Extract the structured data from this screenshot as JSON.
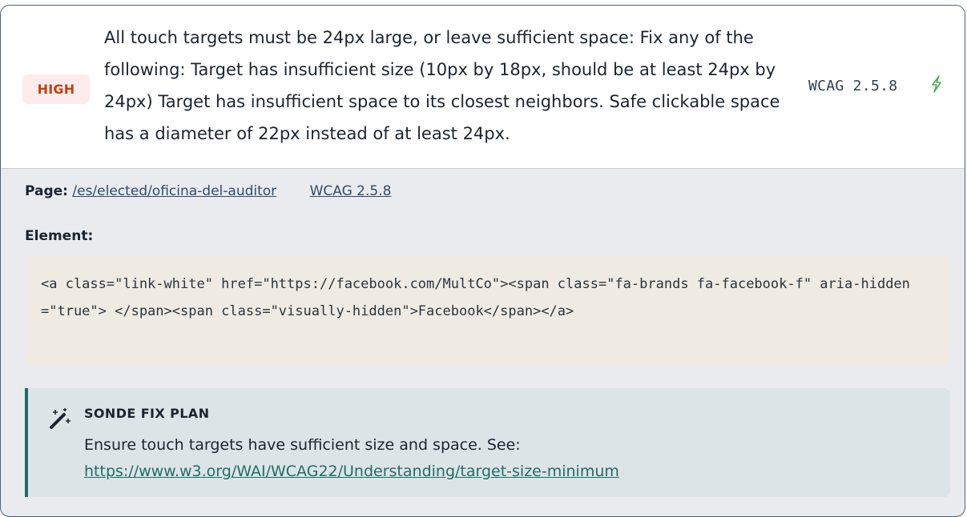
{
  "issue": {
    "severity": "HIGH",
    "description": "All touch targets must be 24px large, or leave sufficient space: Fix any of the following: Target has insufficient size (10px by 18px, should be at least 24px by 24px) Target has insufficient space to its closest neighbors. Safe clickable space has a diameter of 22px instead of at least 24px.",
    "wcag_code": "WCAG 2.5.8",
    "action_icon": "bolt-icon"
  },
  "details": {
    "page_label": "Page:",
    "page_link": "/es/elected/oficina-del-auditor",
    "wcag_link": "WCAG 2.5.8",
    "element_label": "Element:",
    "element_code": "<a class=\"link-white\" href=\"https://facebook.com/MultCo\"><span class=\"fa-brands fa-facebook-f\" aria-hidden=\"true\"> </span><span class=\"visually-hidden\">Facebook</span></a>"
  },
  "fix_plan": {
    "icon": "magic-wand-icon",
    "title": "SONDE FIX PLAN",
    "text": "Ensure touch targets have sufficient size and space. See:",
    "link": "https://www.w3.org/WAI/WCAG22/Understanding/target-size-minimum"
  },
  "colors": {
    "severity_bg": "#fdeceb",
    "severity_text": "#c2410c",
    "accent": "#1f6e66",
    "bolt": "#4caf50"
  }
}
